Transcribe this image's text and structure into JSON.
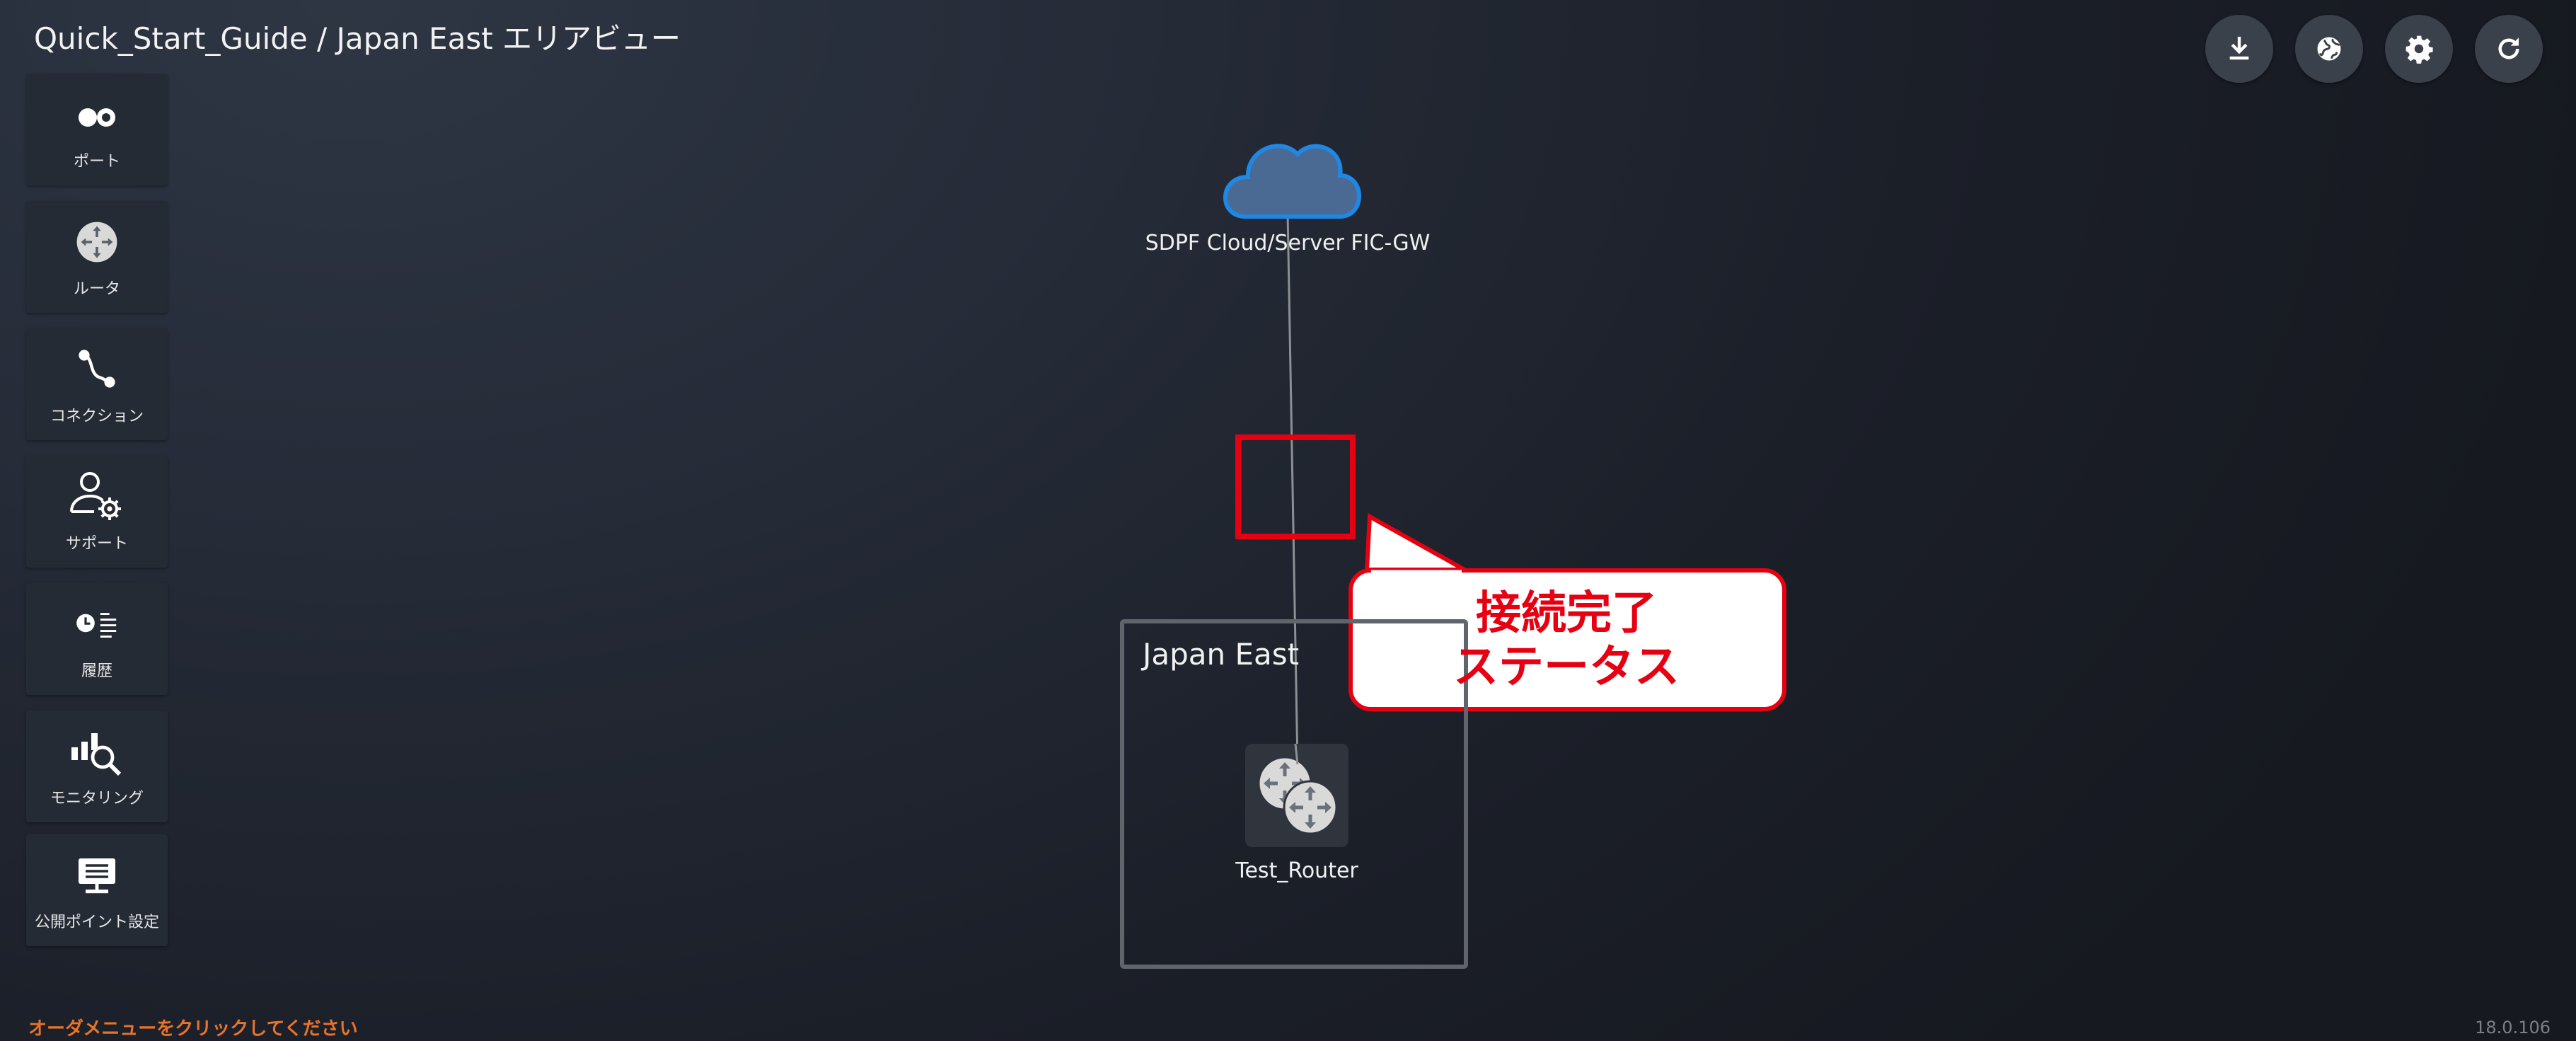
{
  "header": {
    "breadcrumb": "Quick_Start_Guide / Japan East エリアビュー"
  },
  "sidebar": {
    "items": [
      {
        "label": "ポート",
        "icon": "port-icon"
      },
      {
        "label": "ルータ",
        "icon": "router-icon"
      },
      {
        "label": "コネクション",
        "icon": "connection-icon"
      },
      {
        "label": "サポート",
        "icon": "support-icon"
      },
      {
        "label": "履歴",
        "icon": "history-icon"
      },
      {
        "label": "モニタリング",
        "icon": "monitoring-icon"
      },
      {
        "label": "公開ポイント設定",
        "icon": "public-point-icon"
      }
    ]
  },
  "top_actions": [
    {
      "icon": "download-icon"
    },
    {
      "icon": "globe-icon"
    },
    {
      "icon": "gear-icon"
    },
    {
      "icon": "refresh-icon"
    }
  ],
  "canvas": {
    "cloud_node": {
      "label": "SDPF Cloud/Server FIC-GW",
      "icon": "cloud-icon"
    },
    "area": {
      "label": "Japan East"
    },
    "router_node": {
      "label": "Test_Router",
      "icon": "router-pair-icon"
    }
  },
  "annotation": {
    "line1": "接続完了",
    "line2": "ステータス",
    "color": "#e60012"
  },
  "footer": {
    "hint": "オーダメニューをクリックしてください",
    "version": "18.0.106"
  },
  "colors": {
    "background": "#1e222b",
    "panel": "#252b35",
    "accent_orange": "#e8732a",
    "cloud_blue": "#4a6a94"
  }
}
